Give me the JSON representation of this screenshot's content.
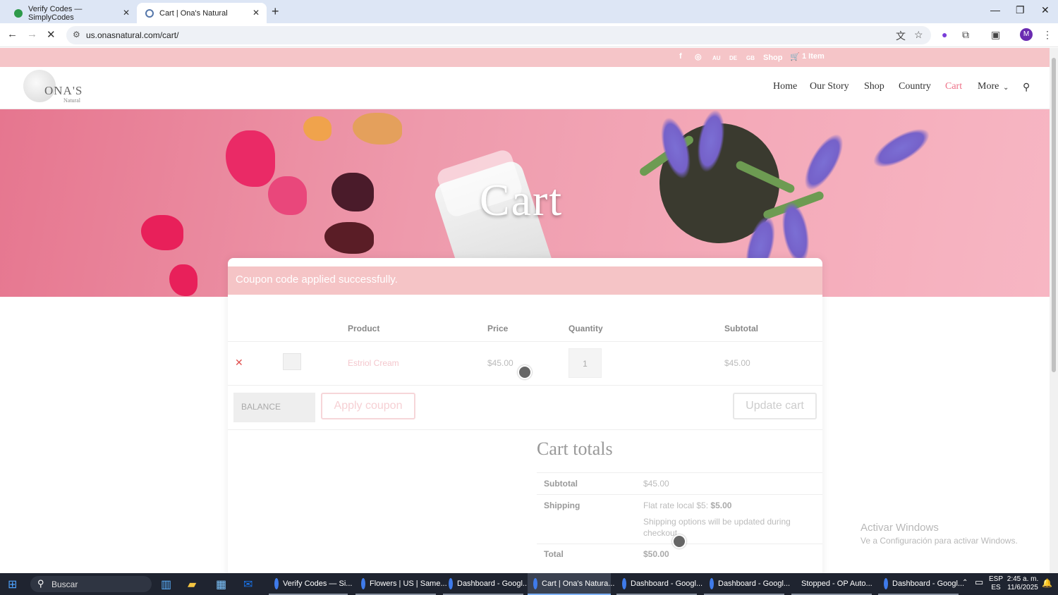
{
  "browser": {
    "tabs": [
      {
        "title": "Verify Codes — SimplyCodes",
        "active": false
      },
      {
        "title": "Cart | Ona's Natural",
        "active": true
      }
    ],
    "url": "us.onasnatural.com/cart/"
  },
  "topbar": {
    "flags": [
      "AU",
      "DE",
      "GB"
    ],
    "shop": "Shop",
    "cart_count": "1 Item"
  },
  "header": {
    "logo_text": "ONA'S",
    "logo_sub": "Natural",
    "nav": [
      "Home",
      "Our Story",
      "Shop",
      "Country",
      "Cart",
      "More"
    ]
  },
  "hero": {
    "title": "Cart"
  },
  "notice": "Coupon code applied successfully.",
  "cart": {
    "headers": {
      "product": "Product",
      "price": "Price",
      "quantity": "Quantity",
      "subtotal": "Subtotal"
    },
    "item": {
      "name": "Estriol Cream",
      "price": "$45.00",
      "quantity": "1",
      "subtotal": "$45.00"
    },
    "coupon_value": "BALANCE",
    "apply_label": "Apply coupon",
    "update_label": "Update cart"
  },
  "totals": {
    "title": "Cart totals",
    "subtotal_label": "Subtotal",
    "subtotal_value": "$45.00",
    "shipping_label": "Shipping",
    "shipping_method": "Flat rate local $5:",
    "shipping_amount": "$5.00",
    "shipping_note": "Shipping options will be updated during checkout.",
    "total_label": "Total",
    "total_value": "$50.00"
  },
  "watermark": {
    "title": "Activar Windows",
    "subtitle": "Ve a Configuración para activar Windows."
  },
  "taskbar": {
    "search": "Buscar",
    "apps": [
      "Verify Codes — Si...",
      "Flowers | US | Same...",
      "Dashboard - Googl...",
      "Cart | Ona's Natura...",
      "Dashboard - Googl...",
      "Dashboard - Googl...",
      "Stopped - OP Auto...",
      "Dashboard - Googl..."
    ],
    "lang_top": "ESP",
    "lang_bottom": "ES",
    "time": "2:45 a. m.",
    "date": "11/6/2025"
  },
  "colors": {
    "accent": "#ee6f86",
    "topbar": "#f5c5c8",
    "notice": "#f5c4c6"
  }
}
